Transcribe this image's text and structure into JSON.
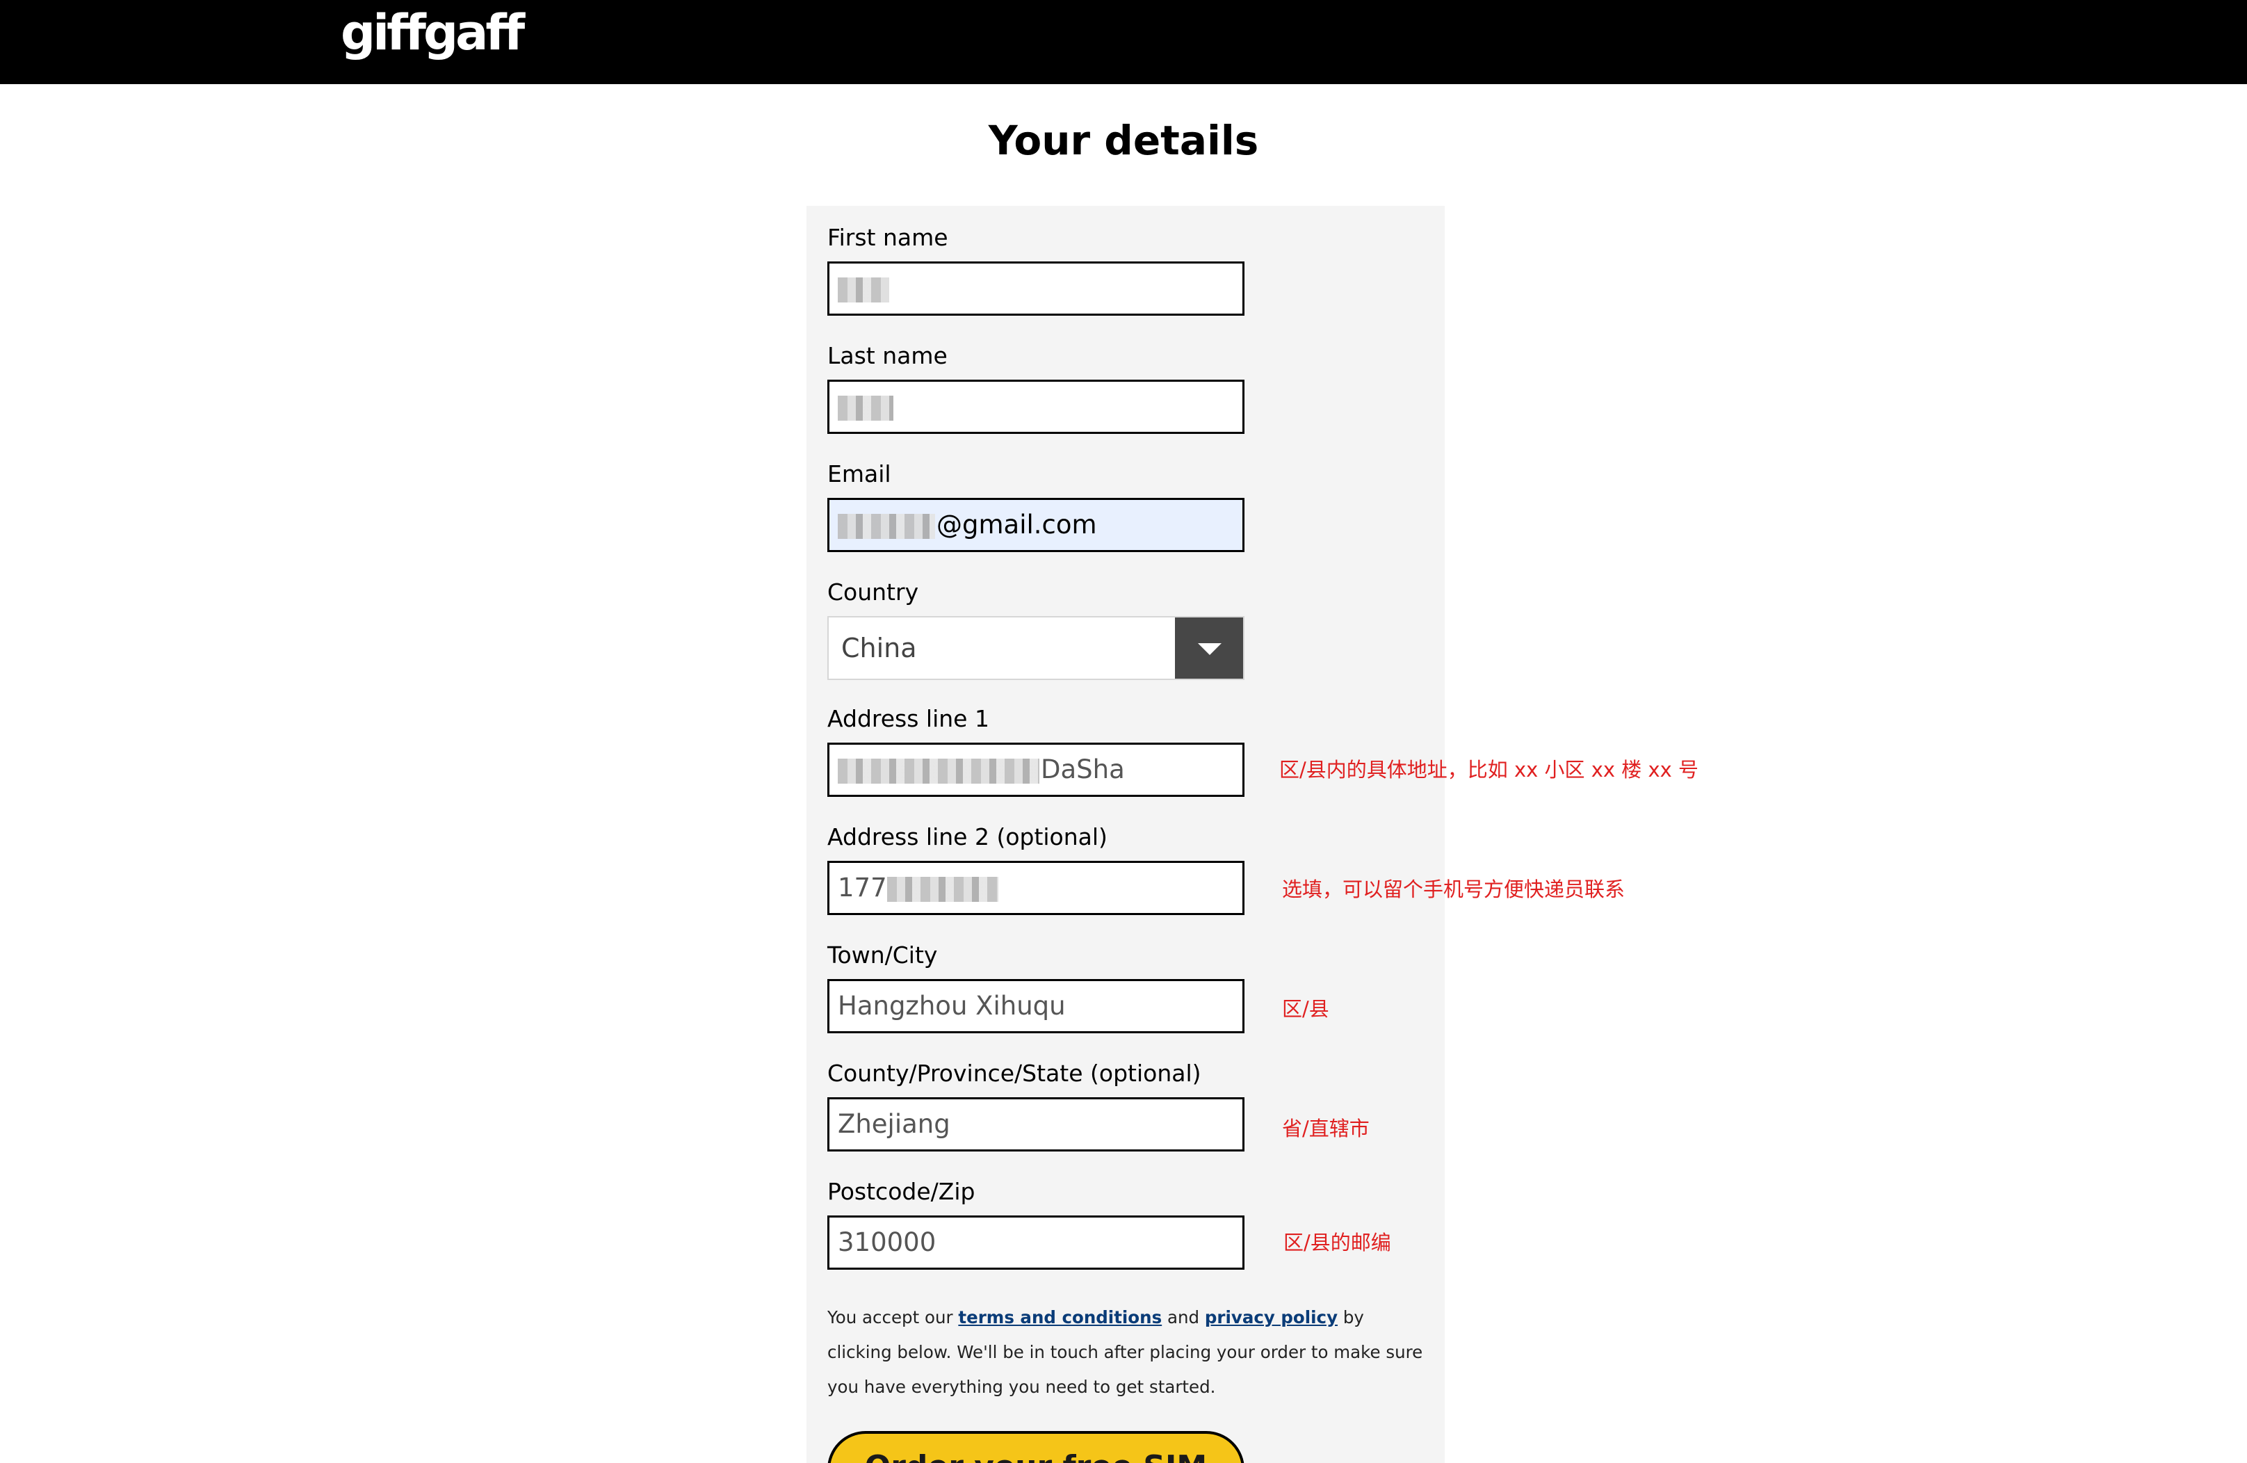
{
  "header": {
    "logo": "giffgaff"
  },
  "page": {
    "title": "Your details"
  },
  "form": {
    "first_name": {
      "label": "First name",
      "value": ""
    },
    "last_name": {
      "label": "Last name",
      "value": ""
    },
    "email": {
      "label": "Email",
      "value": "@gmail.com"
    },
    "country": {
      "label": "Country",
      "value": "China"
    },
    "address1": {
      "label": "Address line 1",
      "value": "DaSha"
    },
    "address2": {
      "label": "Address line 2 (optional)",
      "value": "177"
    },
    "town": {
      "label": "Town/City",
      "value": "Hangzhou Xihuqu"
    },
    "county": {
      "label": "County/Province/State (optional)",
      "value": "Zhejiang"
    },
    "postcode": {
      "label": "Postcode/Zip",
      "value": "310000"
    }
  },
  "annotations": {
    "address1": "区/县内的具体地址，比如 xx 小区 xx 楼 xx 号",
    "address2": "选填，可以留个手机号方便快递员联系",
    "town": "区/县",
    "county": "省/直辖市",
    "postcode": "区/县的邮编"
  },
  "legal": {
    "prefix": "You accept our ",
    "terms_link": "terms and conditions",
    "middle": " and ",
    "privacy_link": "privacy policy",
    "suffix": " by clicking below. We'll be in touch after placing your order to make sure you have everything you need to get started."
  },
  "cta": {
    "label": "Order your free SIM"
  },
  "colors": {
    "header_bg": "#000000",
    "panel_bg": "#f4f4f4",
    "autofill_bg": "#e8f0fe",
    "annotation": "#e02020",
    "link": "#0a3c78",
    "cta_bg": "#f5c518"
  }
}
